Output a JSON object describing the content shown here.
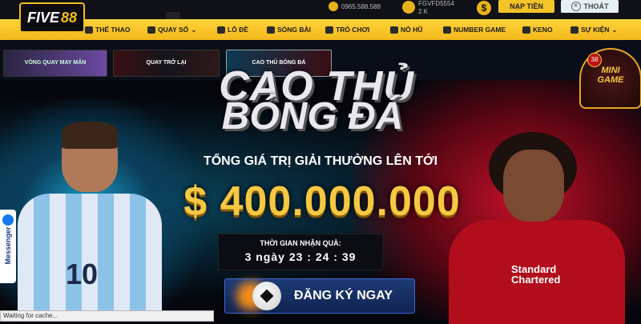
{
  "header": {
    "logo_part1": "FIVE",
    "logo_part2": "88",
    "hotline": "0965.588.588",
    "username": "FGVFD5554",
    "balance": "2 K",
    "deposit_label": "NẠP TIỀN",
    "logout_label": "THOÁT"
  },
  "nav": {
    "items": [
      {
        "label": "THỂ THAO",
        "icon": "soccer-icon"
      },
      {
        "label": "QUAY SỐ",
        "icon": "lottery-icon"
      },
      {
        "label": "LÔ ĐỀ",
        "icon": "globe-icon"
      },
      {
        "label": "SÒNG BÀI",
        "icon": "cards-icon"
      },
      {
        "label": "TRÒ CHƠI",
        "icon": "gamepad-icon"
      },
      {
        "label": "NỔ HŨ",
        "icon": "jackpot-icon"
      },
      {
        "label": "NUMBER GAME",
        "icon": "number-icon"
      },
      {
        "label": "KENO",
        "icon": "keno-icon"
      },
      {
        "label": "SỰ KIỆN",
        "icon": "gift-icon"
      }
    ]
  },
  "promos": {
    "item1": "VÒNG QUAY MAY MẮN",
    "item2": "QUAY TRỞ LẠI",
    "item3": "CAO THỦ BÓNG ĐÁ"
  },
  "hero": {
    "title_line1": "CAO THỦ",
    "title_line2": "BÓNG ĐÁ",
    "subtitle": "TỔNG GIÁ TRỊ GIẢI THƯỞNG LÊN TỚI",
    "amount": "$ 400.000.000",
    "timer_label": "THỜI GIAN NHẬN QUÀ:",
    "timer_value": "3 ngày 23 : 24 : 39",
    "register_label": "ĐĂNG KÝ NGAY",
    "player_left_number": "10",
    "player_right_sponsor1": "Standard",
    "player_right_sponsor2": "Chartered"
  },
  "minigame": {
    "badge": "38",
    "line1": "MINI",
    "line2": "GAME"
  },
  "messenger": {
    "label": "Messenger"
  },
  "status_bar": {
    "text": "Waiting for cache..."
  },
  "colors": {
    "accent": "#f3bd1c",
    "nav_bg": "#f5c427",
    "header_bg": "#101217",
    "register_bg": "#1d3b76"
  }
}
